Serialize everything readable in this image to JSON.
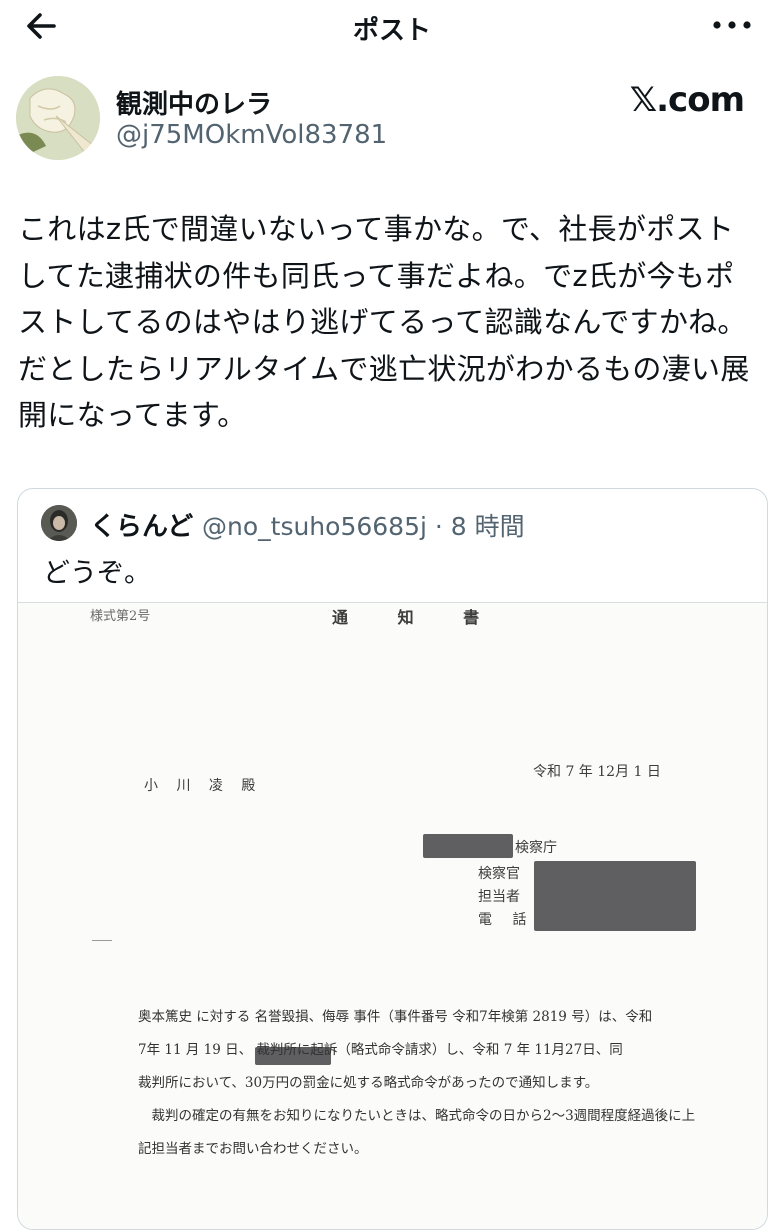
{
  "header": {
    "title": "ポスト"
  },
  "post": {
    "display_name": "観測中のレラ",
    "handle": "@j75MOkmVol83781",
    "brand": "𝕏.com",
    "text_lines": [
      "これはz氏で間違いないって事かな。で、社長がポスト",
      "してた逮捕状の件も同氏って事だよね。でz氏が今もポ",
      "ストしてるのはやはり逃げてるって認識なんですかね。",
      "だとしたらリアルタイムで逃亡状況がわかるもの凄い展",
      "開になってます。"
    ]
  },
  "quote": {
    "display_name": "くらんど",
    "meta": "@no_tsuho56685j · 8 時間",
    "text": "どうぞ。",
    "document": {
      "form_label": "様式第2号",
      "title": "通 知 書",
      "date": "令和 7 年 12月 1 日",
      "recipient": "小 川 凌 殿",
      "office_suffix": "検察庁",
      "label_prosecutor": "検察官",
      "label_contact": "担当者",
      "label_phone": "電 話",
      "dash": "—",
      "body_lines": [
        "奥本篤史 に対する 名誉毀損、侮辱 事件（事件番号 令和7年検第 2819 号）は、令和",
        "7年 11 月 19 日、            裁判所に起訴（略式命令請求）し、令和 7 年 11月27日、同",
        "裁判所において、30万円の罰金に処する略式命令があったので通知します。",
        "　裁判の確定の有無をお知りになりたいときは、略式命令の日から2～3週間程度経過後に上",
        "記担当者までお問い合わせください。"
      ]
    }
  },
  "icons": {
    "back": "arrow-left-icon",
    "more": "more-dots-icon"
  },
  "colors": {
    "text": "#0f1419",
    "secondary": "#536471",
    "border": "#cfd9de",
    "redaction": "#5f5f61"
  }
}
